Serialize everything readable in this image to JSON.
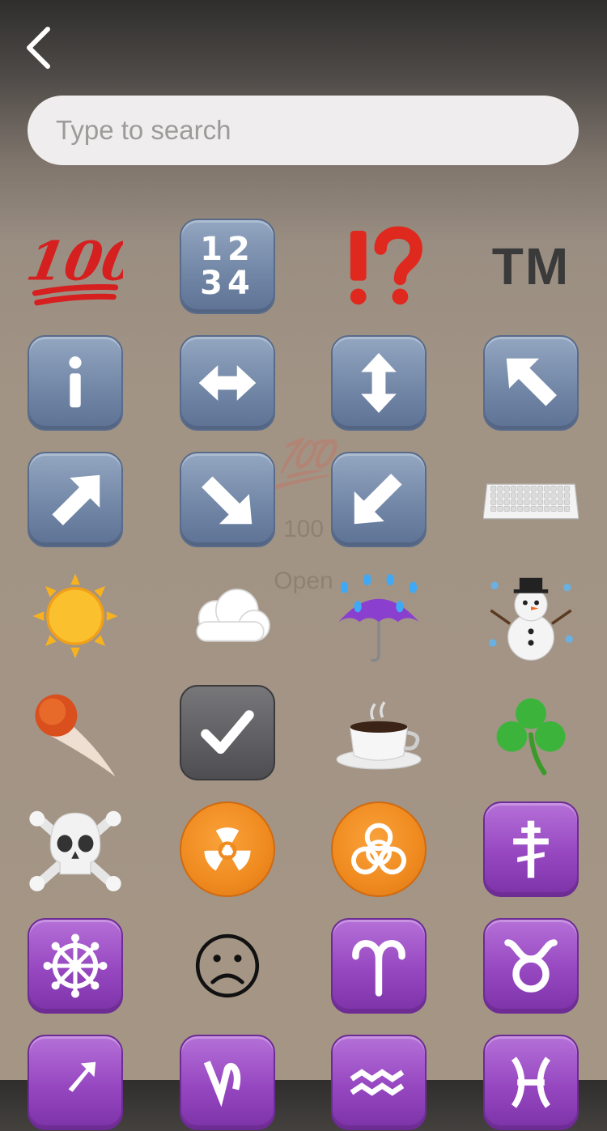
{
  "nav": {
    "back_icon": "chevron-left-icon"
  },
  "search": {
    "placeholder": "Type to search",
    "value": ""
  },
  "tooltip": {
    "emoji": "💯",
    "label": "100",
    "action": "Open"
  },
  "emojis": [
    {
      "name": "hundred-points",
      "glyph": "100",
      "kind": "hundred"
    },
    {
      "name": "input-numbers",
      "glyph": "12\n34",
      "kind": "numbers"
    },
    {
      "name": "exclamation-question-mark",
      "glyph": "⁉",
      "kind": "red-mark"
    },
    {
      "name": "trade-mark",
      "glyph": "TM",
      "kind": "tm"
    },
    {
      "name": "information",
      "glyph": "i",
      "kind": "blue"
    },
    {
      "name": "left-right-arrow",
      "glyph": "↔",
      "kind": "blue"
    },
    {
      "name": "up-down-arrow",
      "glyph": "↕",
      "kind": "blue"
    },
    {
      "name": "up-left-arrow",
      "glyph": "↖",
      "kind": "blue"
    },
    {
      "name": "up-right-arrow",
      "glyph": "↗",
      "kind": "blue"
    },
    {
      "name": "down-right-arrow",
      "glyph": "↘",
      "kind": "blue"
    },
    {
      "name": "down-left-arrow",
      "glyph": "↙",
      "kind": "blue"
    },
    {
      "name": "keyboard",
      "glyph": "⌨",
      "kind": "keyboard"
    },
    {
      "name": "sun",
      "glyph": "☀",
      "kind": "sun"
    },
    {
      "name": "cloud",
      "glyph": "☁",
      "kind": "cloud"
    },
    {
      "name": "umbrella-with-rain-drops",
      "glyph": "☔",
      "kind": "umbrella"
    },
    {
      "name": "snowman",
      "glyph": "☃",
      "kind": "snowman"
    },
    {
      "name": "comet",
      "glyph": "☄",
      "kind": "comet"
    },
    {
      "name": "check-mark-button",
      "glyph": "✔",
      "kind": "gray"
    },
    {
      "name": "hot-beverage",
      "glyph": "☕",
      "kind": "coffee"
    },
    {
      "name": "shamrock",
      "glyph": "☘",
      "kind": "shamrock"
    },
    {
      "name": "skull-and-crossbones",
      "glyph": "☠",
      "kind": "skull"
    },
    {
      "name": "radioactive",
      "glyph": "☢",
      "kind": "disc"
    },
    {
      "name": "biohazard",
      "glyph": "☣",
      "kind": "disc"
    },
    {
      "name": "orthodox-cross",
      "glyph": "☦",
      "kind": "purple"
    },
    {
      "name": "wheel-of-dharma",
      "glyph": "☸",
      "kind": "purple"
    },
    {
      "name": "frowning-face",
      "glyph": "☹",
      "kind": "frown"
    },
    {
      "name": "aries",
      "glyph": "♈",
      "kind": "purple"
    },
    {
      "name": "taurus",
      "glyph": "♉",
      "kind": "purple"
    },
    {
      "name": "sagittarius",
      "glyph": "♐",
      "kind": "purple"
    },
    {
      "name": "capricorn",
      "glyph": "♑",
      "kind": "purple"
    },
    {
      "name": "aquarius",
      "glyph": "♒",
      "kind": "purple"
    },
    {
      "name": "pisces",
      "glyph": "♓",
      "kind": "purple"
    }
  ],
  "colors": {
    "tile_blue": "#7387a7",
    "tile_purple": "#9647c0",
    "disc_orange": "#ef8a1f",
    "search_bg": "#efeded",
    "page_bg": "#a49585"
  }
}
